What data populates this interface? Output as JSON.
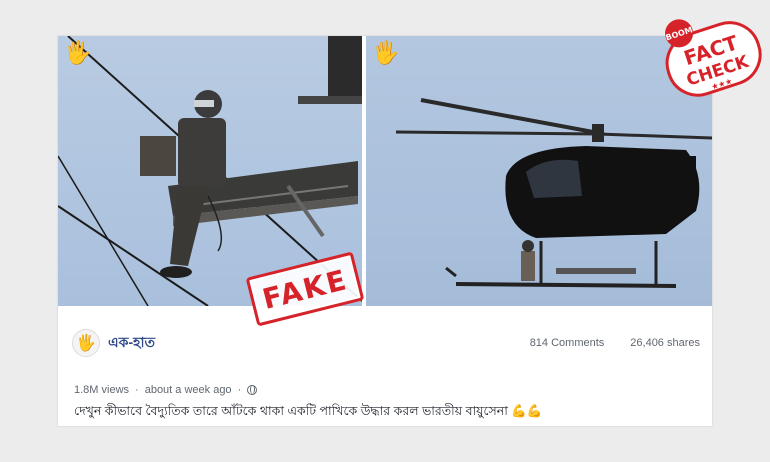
{
  "post": {
    "page_name": "এক-হাত",
    "comments": "814 Comments",
    "shares": "26,406 shares",
    "views": "1.8M views",
    "time": "about a week ago",
    "separator": "·",
    "caption": "দেখুন কীভাবে বৈদ্যুতিক তারে আঁটকে থাকা একটি পাখিকে উদ্ধার করল ভারতীয় বায়ুসেনা 💪💪"
  },
  "stamps": {
    "fake": "FAKE",
    "boom": "BOOM",
    "fact": "FACT",
    "check": "CHECK",
    "stars": "★★★"
  },
  "colors": {
    "page_link": "#2f4a8a",
    "stamp_red": "#d6232a"
  },
  "icons": [
    "hand-logo-icon",
    "globe-icon"
  ]
}
